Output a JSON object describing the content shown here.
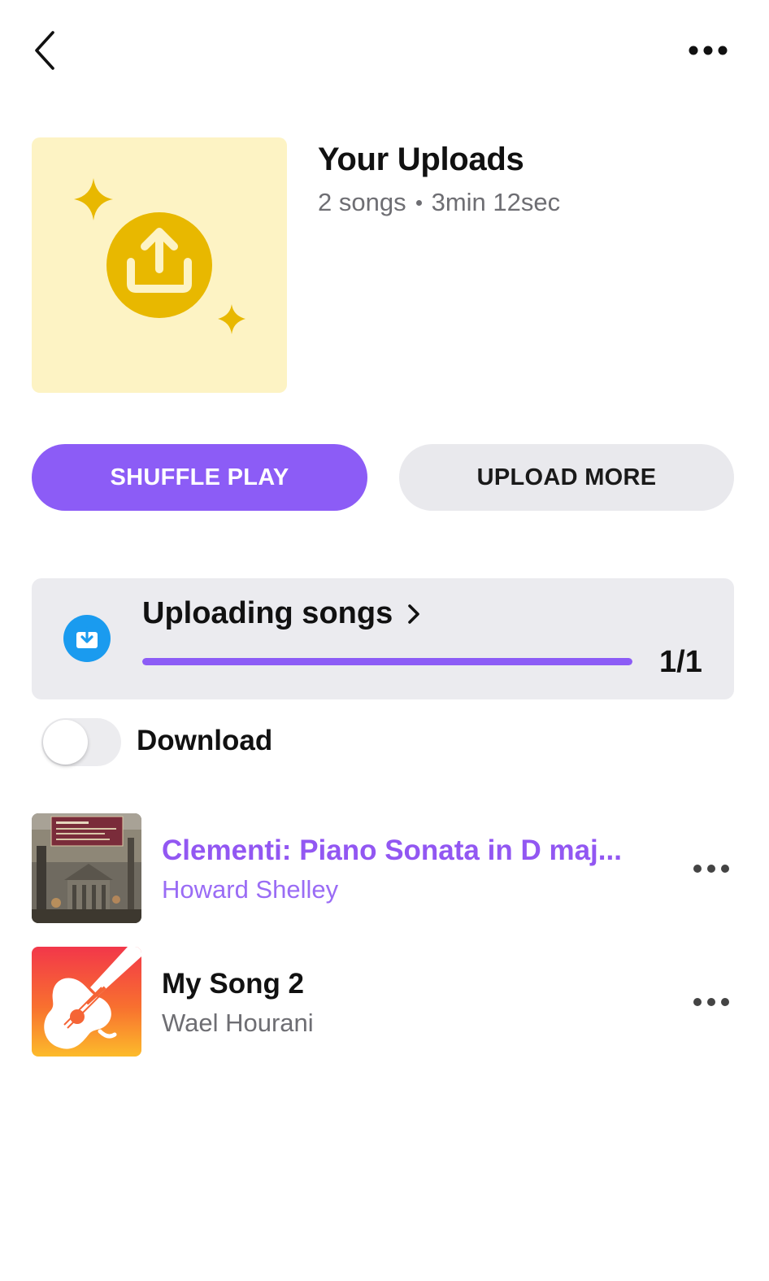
{
  "header": {
    "back_icon": "chevron-left-icon",
    "more_icon": "ellipsis-icon"
  },
  "playlist": {
    "title": "Your Uploads",
    "song_count": "2 songs",
    "duration": "3min 12sec",
    "cover_icon": "upload-circle-icon",
    "cover_color": "#fdf3c4",
    "accent_yellow": "#e8b800"
  },
  "actions": {
    "shuffle_label": "SHUFFLE PLAY",
    "upload_more_label": "UPLOAD MORE",
    "accent_color": "#8c5cf6"
  },
  "upload_status": {
    "title": "Uploading songs",
    "count": "1/1",
    "progress": 1.0,
    "icon": "download-tray-icon",
    "icon_color": "#1a9bef"
  },
  "download": {
    "label": "Download",
    "enabled": false
  },
  "songs": [
    {
      "title": "Clementi: Piano Sonata in D maj...",
      "artist": "Howard Shelley",
      "playing": true
    },
    {
      "title": "My Song 2",
      "artist": "Wael Hourani",
      "playing": false
    }
  ]
}
